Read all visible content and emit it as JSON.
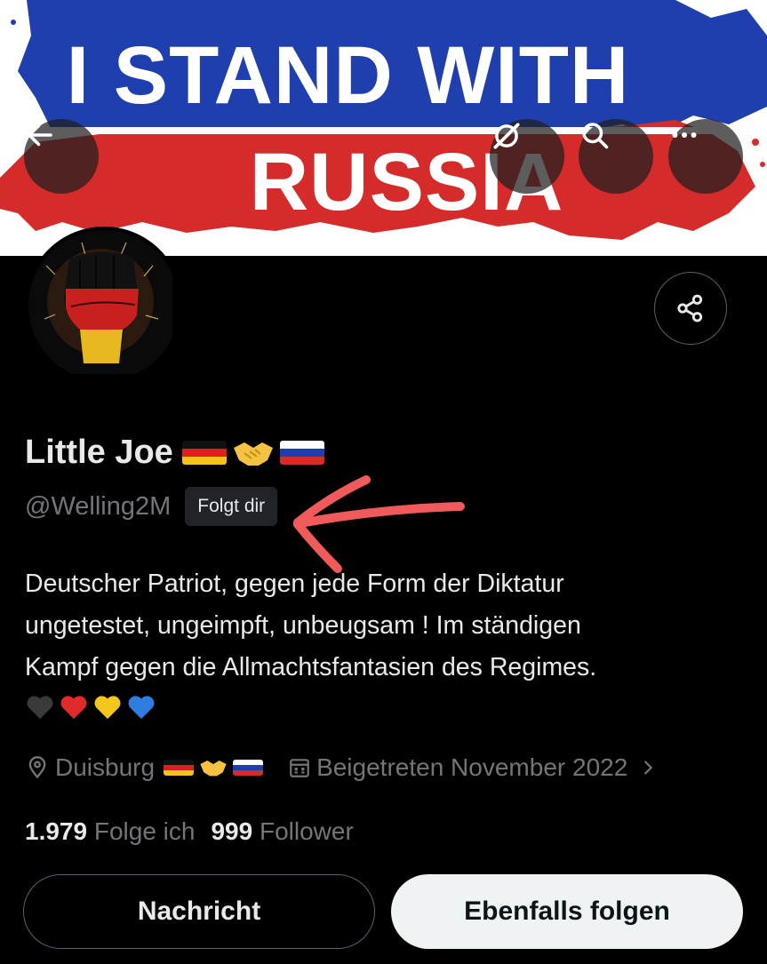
{
  "banner": {
    "line1": "I STAND WITH",
    "line2": "RUSSIA",
    "colors": {
      "blue": "#1f3fae",
      "red": "#d52b2b",
      "white": "#ffffff"
    }
  },
  "toolbar": {
    "back_icon": "arrow-left-icon",
    "translate_icon": "grok-icon",
    "search_icon": "search-icon",
    "more_icon": "more-icon"
  },
  "profile": {
    "display_name": "Little Joe",
    "name_emoji": [
      "flag-germany",
      "handshake",
      "flag-russia"
    ],
    "handle": "@Welling2M",
    "follows_you": "Folgt dir",
    "bio_lines": [
      "Deutscher Patriot, gegen jede Form der Diktatur",
      "ungetestet, ungeimpft, unbeugsam ! Im ständigen",
      "Kampf gegen die Allmachtsfantasien des Regimes."
    ],
    "bio_hearts": [
      "black-heart",
      "red-heart",
      "yellow-heart",
      "blue-heart"
    ],
    "location": "Duisburg",
    "joined": "Beigetreten November 2022",
    "following_count": "1.979",
    "following_label": "Folge ich",
    "followers_count": "999",
    "followers_label": "Follower"
  },
  "actions": {
    "message": "Nachricht",
    "follow_back": "Ebenfalls folgen",
    "share_icon": "share-icon"
  },
  "theme": {
    "background": "#000000",
    "text": "#e7e9ea",
    "muted": "#71767b",
    "annotation": "#f05a5a"
  }
}
